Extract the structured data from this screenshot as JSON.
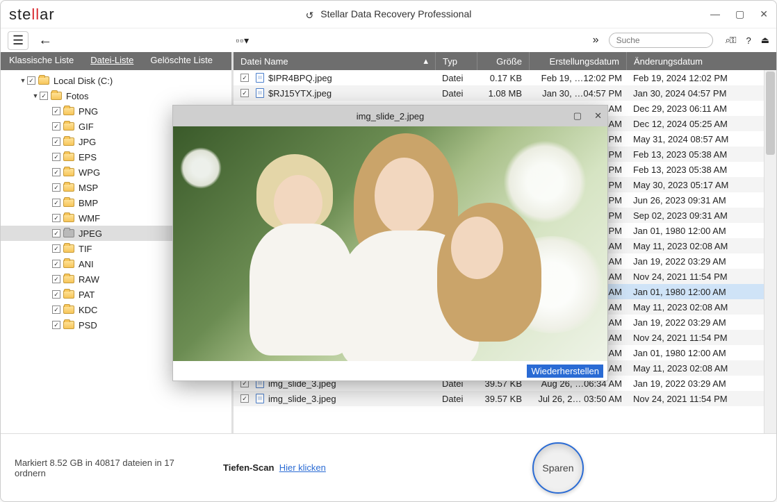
{
  "app_title": "Stellar Data Recovery Professional",
  "logo": {
    "part1": "ste",
    "part2": "ll",
    "part3": "ar"
  },
  "search_placeholder": "Suche",
  "adv_icon": "»",
  "tabs": {
    "classic": "Klassische Liste",
    "file": "Datei-Liste",
    "deleted": "Gelöschte Liste"
  },
  "columns": {
    "name": "Datei Name",
    "type": "Typ",
    "size": "Größe",
    "created": "Erstellungsdatum",
    "modified": "Änderungsdatum"
  },
  "tree": {
    "root": "Local Disk (C:)",
    "fotos": "Fotos",
    "items": [
      "PNG",
      "GIF",
      "JPG",
      "EPS",
      "WPG",
      "MSP",
      "BMP",
      "WMF",
      "JPEG",
      "TIF",
      "ANI",
      "RAW",
      "PAT",
      "KDC",
      "PSD"
    ],
    "selected": "JPEG"
  },
  "files": [
    {
      "name": "$IPR4BPQ.jpeg",
      "type": "Datei",
      "size": "0.17 KB",
      "c": "Feb 19, …12:02 PM",
      "m": "Feb 19, 2024 12:02 PM"
    },
    {
      "name": "$RJ15YTX.jpeg",
      "type": "Datei",
      "size": "1.08 MB",
      "c": "Jan 30, …04:57 PM",
      "m": "Jan 30, 2024 04:57 PM"
    },
    {
      "name": "",
      "type": "",
      "size": "",
      "c": "AM",
      "m": "Dec 29, 2023 06:11 AM"
    },
    {
      "name": "",
      "type": "",
      "size": "",
      "c": "AM",
      "m": "Dec 12, 2024 05:25 AM"
    },
    {
      "name": "",
      "type": "",
      "size": "",
      "c": "PM",
      "m": "May 31, 2024 08:57 AM"
    },
    {
      "name": "",
      "type": "",
      "size": "",
      "c": "PM",
      "m": "Feb 13, 2023 05:38 AM"
    },
    {
      "name": "",
      "type": "",
      "size": "",
      "c": "PM",
      "m": "Feb 13, 2023 05:38 AM"
    },
    {
      "name": "",
      "type": "",
      "size": "",
      "c": "PM",
      "m": "May 30, 2023 05:17 AM"
    },
    {
      "name": "",
      "type": "",
      "size": "",
      "c": "PM",
      "m": "Jun 26, 2023 09:31 AM"
    },
    {
      "name": "",
      "type": "",
      "size": "",
      "c": "PM",
      "m": "Sep 02, 2023 09:31 AM"
    },
    {
      "name": "",
      "type": "",
      "size": "",
      "c": "PM",
      "m": "Jan 01, 1980 12:00 AM"
    },
    {
      "name": "",
      "type": "",
      "size": "",
      "c": "AM",
      "m": "May 11, 2023 02:08 AM"
    },
    {
      "name": "",
      "type": "",
      "size": "",
      "c": "AM",
      "m": "Jan 19, 2022 03:29 AM"
    },
    {
      "name": "",
      "type": "",
      "size": "",
      "c": "AM",
      "m": "Nov 24, 2021 11:54 PM"
    },
    {
      "name": "",
      "type": "",
      "size": "",
      "c": "AM",
      "m": "Jan 01, 1980 12:00 AM",
      "hl": true
    },
    {
      "name": "",
      "type": "",
      "size": "",
      "c": "AM",
      "m": "May 11, 2023 02:08 AM"
    },
    {
      "name": "",
      "type": "",
      "size": "",
      "c": "AM",
      "m": "Jan 19, 2022 03:29 AM"
    },
    {
      "name": "",
      "type": "",
      "size": "",
      "c": "AM",
      "m": "Nov 24, 2021 11:54 PM"
    },
    {
      "name": "",
      "type": "",
      "size": "",
      "c": "AM",
      "m": "Jan 01, 1980 12:00 AM"
    },
    {
      "name": "",
      "type": "",
      "size": "",
      "c": "AM",
      "m": "May 11, 2023 02:08 AM"
    },
    {
      "name": "img_slide_3.jpeg",
      "type": "Datei",
      "size": "39.57 KB",
      "c": "Aug 26, …06:34 AM",
      "m": "Jan 19, 2022 03:29 AM"
    },
    {
      "name": "img_slide_3.jpeg",
      "type": "Datei",
      "size": "39.57 KB",
      "c": "Jul 26, 2… 03:50 AM",
      "m": "Nov 24, 2021 11:54 PM"
    }
  ],
  "preview": {
    "filename": "img_slide_2.jpeg",
    "recover": "Wiederherstellen"
  },
  "footer": {
    "status": "Markiert 8.52 GB in 40817 dateien in 17 ordnern",
    "deep_label": "Tiefen-Scan",
    "deep_link": "Hier klicken",
    "save": "Sparen"
  }
}
